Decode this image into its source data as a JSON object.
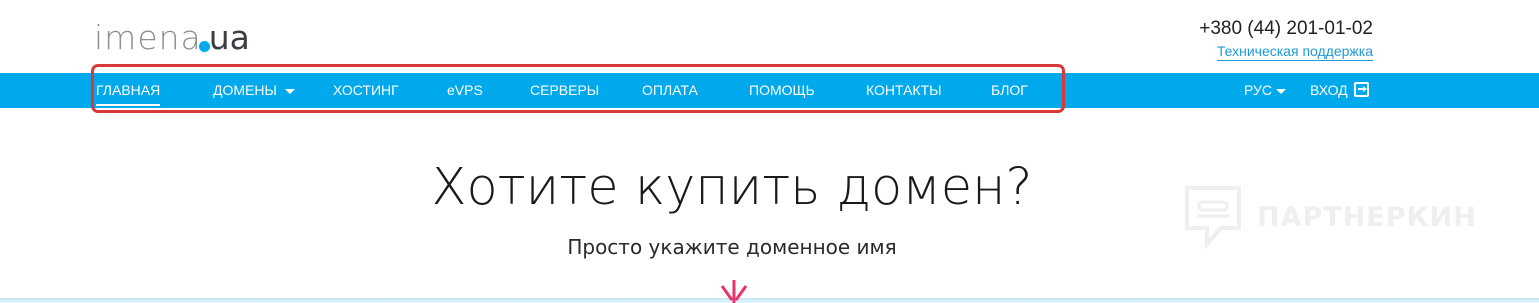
{
  "logo": {
    "name": "imena",
    "tld": "ua"
  },
  "header": {
    "phone": "+380 (44) 201-01-02",
    "support_link": "Техническая поддержка"
  },
  "nav": {
    "items": [
      {
        "label": "ГЛАВНАЯ",
        "active": true
      },
      {
        "label": "ДОМЕНЫ",
        "has_dropdown": true
      },
      {
        "label": "ХОСТИНГ"
      },
      {
        "label": "eVPS"
      },
      {
        "label": "СЕРВЕРЫ"
      },
      {
        "label": "ОПЛАТА"
      },
      {
        "label": "ПОМОЩЬ"
      },
      {
        "label": "КОНТАКТЫ"
      },
      {
        "label": "БЛОГ"
      }
    ],
    "language": "РУС",
    "login": "ВХОД"
  },
  "hero": {
    "title": "Хотите купить домен?",
    "subtitle": "Просто укажите доменное имя"
  },
  "watermark": {
    "text": "ПАРТНЕРКИН"
  },
  "colors": {
    "nav_bg": "#00a8ec",
    "highlight": "#d9393b",
    "link": "#1e9ad6",
    "accent_pink": "#e8336b"
  },
  "icons": [
    "caret-down-icon",
    "login-icon",
    "shield-icon",
    "burst-icon"
  ]
}
